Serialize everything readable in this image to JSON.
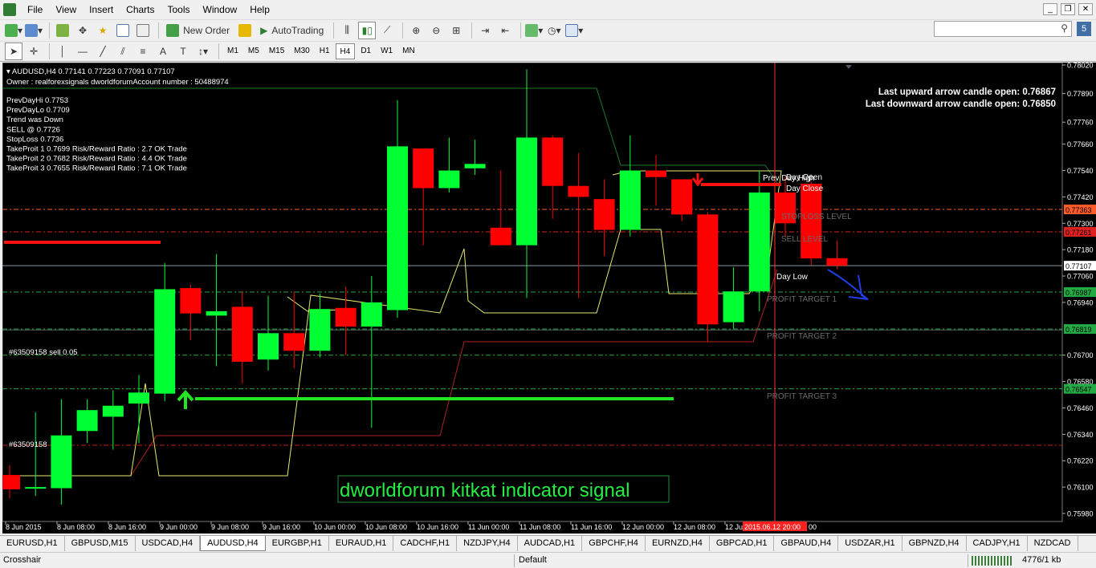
{
  "menu": [
    "File",
    "View",
    "Insert",
    "Charts",
    "Tools",
    "Window",
    "Help"
  ],
  "toolbar": {
    "new_order": "New Order",
    "autotrading": "AutoTrading"
  },
  "timeframes": [
    "M1",
    "M5",
    "M15",
    "M30",
    "H1",
    "H4",
    "D1",
    "W1",
    "MN"
  ],
  "active_timeframe": "H4",
  "notification_count": "5",
  "chart": {
    "header": "AUDUSD,H4  0.77141 0.77223 0.77091 0.77107",
    "owner": "Owner : realforexsignals dworldforumAccount number : 50488974",
    "info_lines": [
      "PrevDayHi 0.7753",
      "PrevDayLo 0.7709",
      "Trend was Down",
      "SELL @ 0.7726",
      "StopLoss 0.7736",
      "TakeProit 1 0.7699 Risk/Reward Ratio : 2.7 OK Trade",
      "TakeProit 2 0.7682 Risk/Reward Ratio : 4.4 OK Trade",
      "TakeProit 3 0.7655 Risk/Reward Ratio : 7.1 OK Trade"
    ],
    "arrow_up": "Last upward arrow candle open: 0.76867",
    "arrow_down": "Last downward arrow candle open: 0.76850",
    "order_label_1": "#63509158 sell 0.05",
    "order_label_2": "#63509158",
    "watermark": "dworldforum kitkat indicator signal",
    "level_labels": {
      "prev_day_high": "Prev Day High",
      "day_open": "Day Open",
      "day_close": "Day Close",
      "stop_loss": "STOPLOSS LEVEL",
      "sell": "SELL LEVEL",
      "day_low": "Day Low",
      "pt1": "PROFIT TARGET 1",
      "pt2": "PROFIT TARGET 2",
      "pt3": "PROFIT TARGET 3"
    },
    "price_axis": [
      "0.78020",
      "0.77890",
      "0.77760",
      "0.77660",
      "0.77540",
      "0.77420",
      "0.77300",
      "0.77180",
      "0.77060",
      "0.76940",
      "0.76700",
      "0.76580",
      "0.76460",
      "0.76340",
      "0.76220",
      "0.76100",
      "0.75980"
    ],
    "price_tags": [
      {
        "value": "0.77363",
        "color": "#ff5a2a"
      },
      {
        "value": "0.77261",
        "color": "#e02020"
      },
      {
        "value": "0.77107",
        "color": "#ffffff"
      },
      {
        "value": "0.76987",
        "color": "#22aa44"
      },
      {
        "value": "0.76819",
        "color": "#22aa44"
      },
      {
        "value": "0.76547",
        "color": "#22aa44"
      }
    ],
    "time_axis": [
      "8 Jun 2015",
      "8 Jun 08:00",
      "8 Jun 16:00",
      "9 Jun 00:00",
      "9 Jun 08:00",
      "9 Jun 16:00",
      "10 Jun 00:00",
      "10 Jun 08:00",
      "10 Jun 16:00",
      "11 Jun 00:00",
      "11 Jun 08:00",
      "11 Jun 16:00",
      "12 Jun 00:00",
      "12 Jun 08:00",
      "12 Jun"
    ],
    "cursor_time": "2015.06.12 20:00",
    "cursor_time_tail": "00",
    "candles": [
      {
        "o": 0.76155,
        "h": 0.762,
        "l": 0.7605,
        "c": 0.7609
      },
      {
        "o": 0.761,
        "h": 0.7644,
        "l": 0.7606,
        "c": 0.761
      },
      {
        "o": 0.76095,
        "h": 0.765,
        "l": 0.7602,
        "c": 0.76335
      },
      {
        "o": 0.76355,
        "h": 0.765,
        "l": 0.763,
        "c": 0.7645
      },
      {
        "o": 0.7642,
        "h": 0.7654,
        "l": 0.7627,
        "c": 0.7647
      },
      {
        "o": 0.7648,
        "h": 0.7661,
        "l": 0.763,
        "c": 0.7653
      },
      {
        "o": 0.76525,
        "h": 0.7712,
        "l": 0.7649,
        "c": 0.77
      },
      {
        "o": 0.77005,
        "h": 0.7702,
        "l": 0.7677,
        "c": 0.7689
      },
      {
        "o": 0.7688,
        "h": 0.7716,
        "l": 0.7665,
        "c": 0.769
      },
      {
        "o": 0.7692,
        "h": 0.7699,
        "l": 0.7657,
        "c": 0.7667
      },
      {
        "o": 0.7668,
        "h": 0.7697,
        "l": 0.7663,
        "c": 0.768
      },
      {
        "o": 0.768,
        "h": 0.7699,
        "l": 0.7664,
        "c": 0.7672
      },
      {
        "o": 0.7672,
        "h": 0.7698,
        "l": 0.7669,
        "c": 0.7691
      },
      {
        "o": 0.76915,
        "h": 0.7701,
        "l": 0.767,
        "c": 0.7683
      },
      {
        "o": 0.7683,
        "h": 0.7706,
        "l": 0.7637,
        "c": 0.7694
      },
      {
        "o": 0.76905,
        "h": 0.7786,
        "l": 0.7687,
        "c": 0.7765
      },
      {
        "o": 0.7764,
        "h": 0.776,
        "l": 0.772,
        "c": 0.7746
      },
      {
        "o": 0.7746,
        "h": 0.7769,
        "l": 0.7744,
        "c": 0.7754
      },
      {
        "o": 0.7755,
        "h": 0.7768,
        "l": 0.7752,
        "c": 0.7757
      },
      {
        "o": 0.7728,
        "h": 0.7754,
        "l": 0.7724,
        "c": 0.772
      },
      {
        "o": 0.772,
        "h": 0.78,
        "l": 0.7696,
        "c": 0.7769
      },
      {
        "o": 0.7769,
        "h": 0.777,
        "l": 0.7732,
        "c": 0.7747
      },
      {
        "o": 0.7747,
        "h": 0.7762,
        "l": 0.7696,
        "c": 0.7742
      },
      {
        "o": 0.7741,
        "h": 0.775,
        "l": 0.7715,
        "c": 0.7727
      },
      {
        "o": 0.7727,
        "h": 0.777,
        "l": 0.7724,
        "c": 0.7754
      },
      {
        "o": 0.7754,
        "h": 0.7761,
        "l": 0.7738,
        "c": 0.7751
      },
      {
        "o": 0.775,
        "h": 0.774,
        "l": 0.7731,
        "c": 0.7734
      },
      {
        "o": 0.7734,
        "h": 0.7735,
        "l": 0.7676,
        "c": 0.7684
      },
      {
        "o": 0.7685,
        "h": 0.771,
        "l": 0.7682,
        "c": 0.7699
      },
      {
        "o": 0.7699,
        "h": 0.7754,
        "l": 0.769,
        "c": 0.7744
      },
      {
        "o": 0.7744,
        "h": 0.7751,
        "l": 0.7724,
        "c": 0.773
      },
      {
        "o": 0.7748,
        "h": 0.7749,
        "l": 0.7711,
        "c": 0.7714
      },
      {
        "o": 0.77141,
        "h": 0.77223,
        "l": 0.77091,
        "c": 0.77107
      }
    ]
  },
  "tabs": [
    "EURUSD,H1",
    "GBPUSD,M15",
    "USDCAD,H4",
    "AUDUSD,H4",
    "EURGBP,H1",
    "EURAUD,H1",
    "CADCHF,H1",
    "NZDJPY,H4",
    "AUDCAD,H1",
    "GBPCHF,H4",
    "EURNZD,H4",
    "GBPCAD,H1",
    "GBPAUD,H4",
    "USDZAR,H1",
    "GBPNZD,H4",
    "CADJPY,H1",
    "NZDCAD"
  ],
  "active_tab": "AUDUSD,H4",
  "status": {
    "mode": "Crosshair",
    "profile": "Default",
    "traffic": "4776/1 kb"
  }
}
